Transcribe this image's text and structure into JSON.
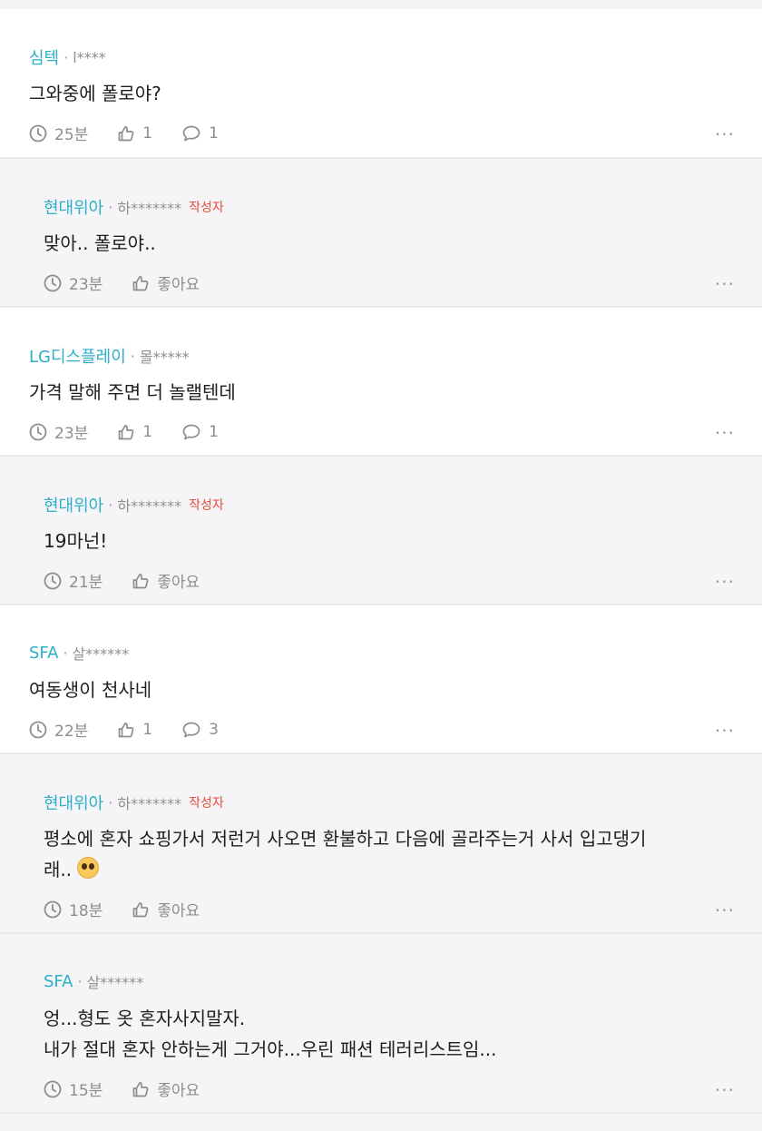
{
  "comments": [
    {
      "type": "top",
      "author": "심텍",
      "user": "l****",
      "is_author": false,
      "lines": [
        "그와중에 폴로야?"
      ],
      "time": "25분",
      "likes": "1",
      "replies": "1"
    },
    {
      "type": "reply",
      "author": "현대위아",
      "user": "하*******",
      "is_author": true,
      "lines": [
        "맞아.. 폴로야.."
      ],
      "time": "23분",
      "like_label": "좋아요"
    },
    {
      "type": "top",
      "author": "LG디스플레이",
      "user": "몰*****",
      "is_author": false,
      "lines": [
        "가격 말해 주면 더 놀랠텐데"
      ],
      "time": "23분",
      "likes": "1",
      "replies": "1"
    },
    {
      "type": "reply",
      "author": "현대위아",
      "user": "하*******",
      "is_author": true,
      "lines": [
        "19마넌!"
      ],
      "time": "21분",
      "like_label": "좋아요"
    },
    {
      "type": "top",
      "author": "SFA",
      "user": "살******",
      "is_author": false,
      "lines": [
        "여동생이 천사네"
      ],
      "time": "22분",
      "likes": "1",
      "replies": "3"
    },
    {
      "type": "reply",
      "author": "현대위아",
      "user": "하*******",
      "is_author": true,
      "lines": [
        "평소에 혼자 쇼핑가서 저런거 사오면 환불하고 다음에 골라주는거 사서 입고댕기",
        "래.."
      ],
      "emoji": "pleading-face-emoji",
      "time": "18분",
      "like_label": "좋아요"
    },
    {
      "type": "reply",
      "author": "SFA",
      "user": "살******",
      "is_author": false,
      "lines": [
        "엉...형도 옷 혼자사지말자.",
        "내가 절대 혼자 안하는게 그거야...우린 패션 테러리스트임..."
      ],
      "time": "15분",
      "like_label": "좋아요"
    }
  ],
  "labels": {
    "author_badge": "작성자",
    "separator": "·",
    "more": "···"
  },
  "icons": {
    "time": "clock-icon",
    "like": "thumbs-up-icon",
    "reply": "speech-bubble-icon",
    "more": "more-dots-icon"
  },
  "colors": {
    "author": "#2eaec7",
    "badge": "#e74b3c",
    "top_bg": "#ffffff",
    "reply_bg": "#f5f5f7"
  }
}
